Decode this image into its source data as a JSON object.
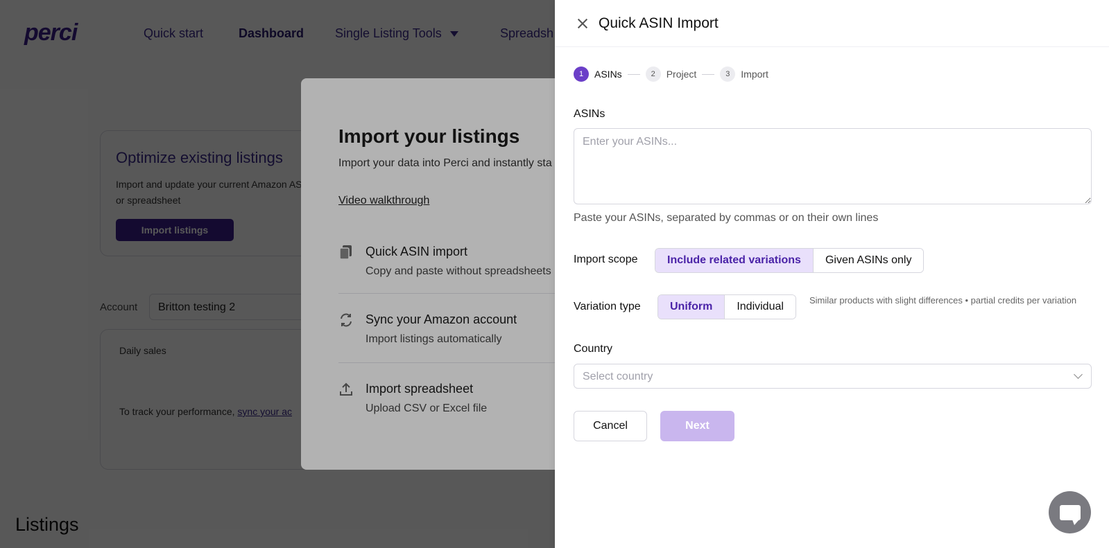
{
  "app": {
    "logo": "perci",
    "nav": [
      {
        "label": "Quick start"
      },
      {
        "label": "Dashboard"
      },
      {
        "label": "Single Listing Tools"
      },
      {
        "label": "Spreadsh"
      }
    ],
    "optimize_card": {
      "title": "Optimize existing listings",
      "description": "Import and update your current Amazon ASINs or spreadsheet",
      "button": "Import listings"
    },
    "account": {
      "label": "Account",
      "value": "Britton testing 2"
    },
    "sales_card": {
      "title": "Daily sales",
      "message_prefix": "To track your performance,",
      "message_link": "sync your ac"
    },
    "listings_title": "Listings"
  },
  "import_modal": {
    "title": "Import your listings",
    "subtitle": "Import your data into Perci and instantly sta online.",
    "walkthrough": "Video walkthrough",
    "options": [
      {
        "icon": "document-stack-icon",
        "title": "Quick ASIN import",
        "description": "Copy and paste without spreadsheets"
      },
      {
        "icon": "sync-icon",
        "title": "Sync your Amazon account",
        "description": "Import listings automatically"
      },
      {
        "icon": "upload-icon",
        "title": "Import spreadsheet",
        "description": "Upload CSV or Excel file"
      }
    ]
  },
  "drawer": {
    "title": "Quick ASIN Import",
    "steps": [
      {
        "number": "1",
        "label": "ASINs",
        "active": true
      },
      {
        "number": "2",
        "label": "Project",
        "active": false
      },
      {
        "number": "3",
        "label": "Import",
        "active": false
      }
    ],
    "asins": {
      "label": "ASINs",
      "placeholder": "Enter your ASINs...",
      "value": "",
      "help": "Paste your ASINs, separated by commas or on their own lines"
    },
    "import_scope": {
      "label": "Import scope",
      "options": [
        "Include related variations",
        "Given ASINs only"
      ],
      "selected": "Include related variations"
    },
    "variation_type": {
      "label": "Variation type",
      "options": [
        "Uniform",
        "Individual"
      ],
      "selected": "Uniform",
      "hint": "Similar products with slight differences • partial credits per variation"
    },
    "country": {
      "label": "Country",
      "placeholder": "Select country"
    },
    "buttons": {
      "cancel": "Cancel",
      "next": "Next"
    }
  },
  "colors": {
    "accent": "#6b3fc8",
    "brand_dark": "#3a1f8a",
    "selected_bg": "#e9e0fb",
    "next_disabled": "#c9b6ee"
  }
}
